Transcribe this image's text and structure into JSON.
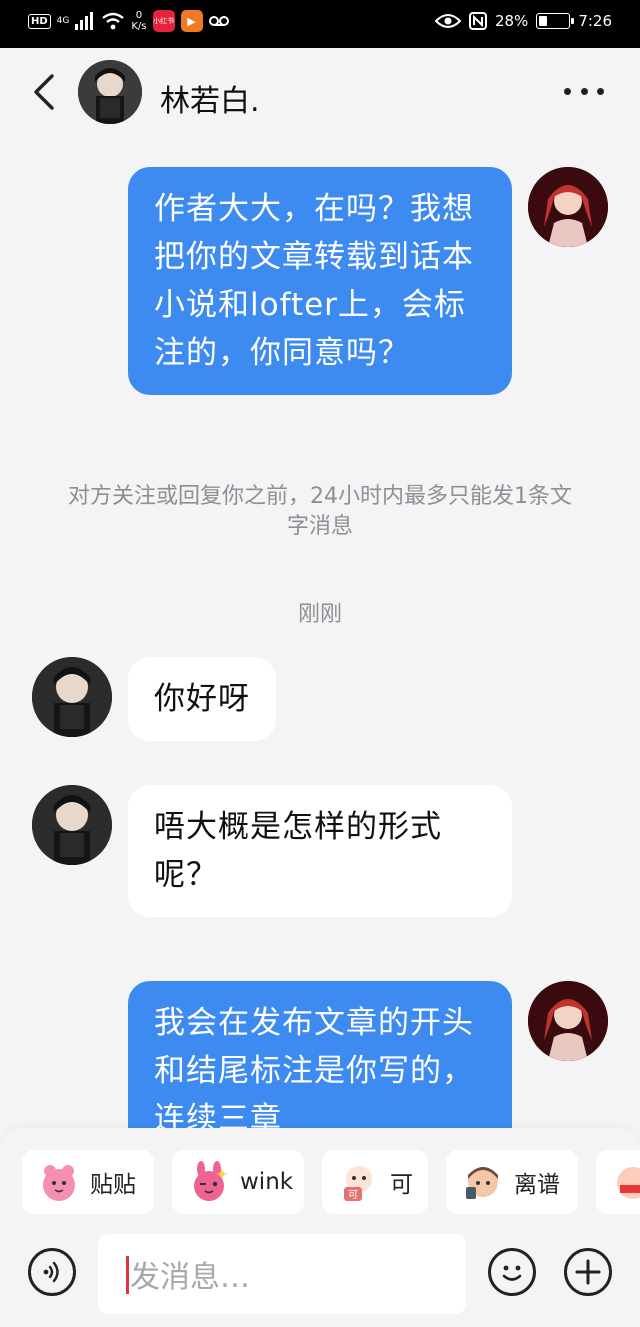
{
  "status_bar": {
    "hd": "HD",
    "signal": "4G",
    "net_speed_value": "0",
    "net_speed_unit": "K/s",
    "app_badge_1": "小红书",
    "battery": "28%",
    "battery_level": 0.28,
    "time": "7:26"
  },
  "header": {
    "name": "林若白."
  },
  "messages": [
    {
      "side": "out",
      "text": "作者大大，在吗？我想把你的文章转载到话本小说和lofter上，会标注的，你同意吗？"
    },
    {
      "side": "in",
      "text": "你好呀"
    },
    {
      "side": "in",
      "text": "唔大概是怎样的形式呢？"
    },
    {
      "side": "out",
      "text": "我会在发布文章的开头和结尾标注是你写的，连续三章"
    }
  ],
  "notice": "对方关注或回复你之前，24小时内最多只能发1条文字消息",
  "timestamp": "刚刚",
  "stickers": [
    "贴贴",
    "wink",
    "可",
    "离谱"
  ],
  "input": {
    "placeholder": "发消息…"
  },
  "colors": {
    "accent": "#3d8bf0",
    "background": "#f4f4f6"
  }
}
